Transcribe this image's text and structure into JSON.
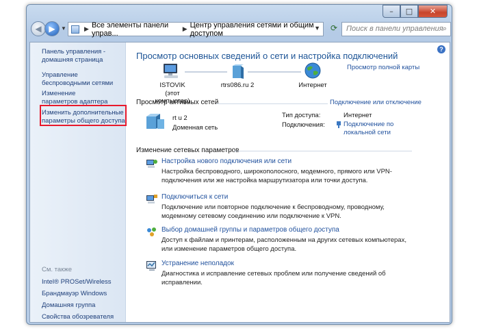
{
  "window": {
    "caption": {
      "minimize": "–",
      "maximize": "□",
      "close": "✕"
    }
  },
  "navbar": {
    "breadcrumb": [
      "Все элементы панели управ...",
      "Центр управления сетями и общим доступом"
    ],
    "search_placeholder": "Поиск в панели управления"
  },
  "sidebar": {
    "items": [
      "Панель управления - домашняя страница",
      "Управление беспроводными сетями",
      "Изменение параметров адаптера",
      "Изменить дополнительные параметры общего доступа"
    ],
    "see_also_title": "См. также",
    "see_also": [
      "Intel® PROSet/Wireless",
      "Брандмауэр Windows",
      "Домашняя группа",
      "Свойства обозревателя"
    ]
  },
  "main": {
    "title": "Просмотр основных сведений о сети и настройка подключений",
    "full_map_link": "Просмотр полной карты",
    "map": {
      "computer_name": "ISTOVIK",
      "computer_sub": "(этот компьютер)",
      "network": "rtrs086.ru  2",
      "internet": "Интернет"
    },
    "active": {
      "title": "Просмотр активных сетей",
      "connect_link": "Подключение или отключение",
      "network_name": "rt          u 2",
      "network_type": "Доменная сеть",
      "access_label": "Тип доступа:",
      "access_value": "Интернет",
      "connections_label": "Подключения:",
      "connections_value": "Подключение по локальной сети"
    },
    "change": {
      "title": "Изменение сетевых параметров",
      "tasks": [
        {
          "title": "Настройка нового подключения или сети",
          "desc": "Настройка беспроводного, широкополосного, модемного, прямого или VPN-подключения или же настройка маршрутизатора или точки доступа.",
          "icon": "network-setup-icon"
        },
        {
          "title": "Подключиться к сети",
          "desc": "Подключение или повторное подключение к беспроводному, проводному, модемному сетевому соединению или подключение к VPN.",
          "icon": "connect-network-icon"
        },
        {
          "title": "Выбор домашней группы и параметров общего доступа",
          "desc": "Доступ к файлам и принтерам, расположенным на других сетевых компьютерах, или изменение параметров общего доступа.",
          "icon": "homegroup-icon"
        },
        {
          "title": "Устранение неполадок",
          "desc": "Диагностика и исправление сетевых проблем или получение сведений об исправлении.",
          "icon": "troubleshoot-icon"
        }
      ]
    }
  }
}
